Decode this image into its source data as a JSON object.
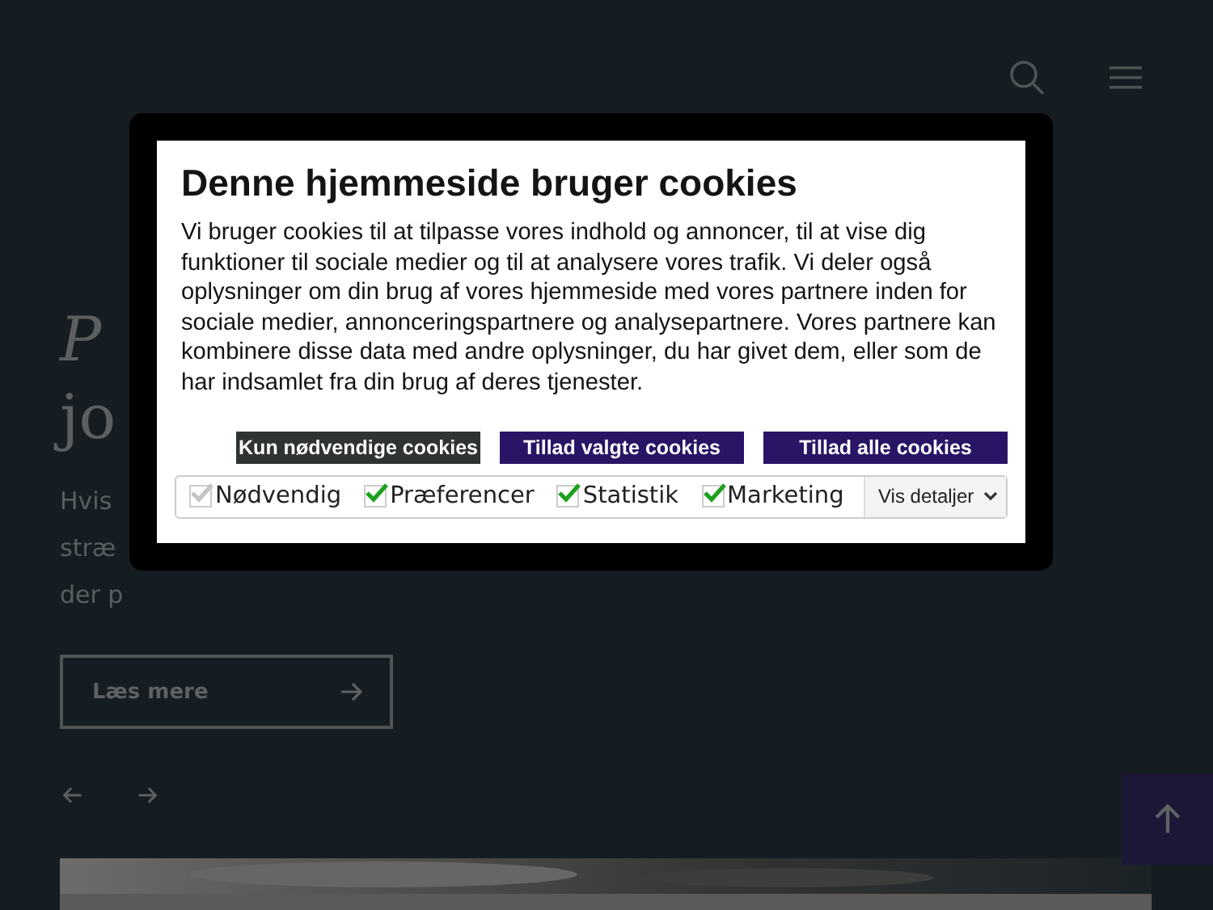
{
  "page": {
    "headline": [
      "P",
      "jo"
    ],
    "intro": [
      "Hvis",
      "stræ",
      "der p"
    ],
    "read_more": "Læs mere",
    "picture": {
      "kind": "picture"
    }
  },
  "dialog": {
    "title": "Denne hjemmeside bruger cookies",
    "body": "Vi bruger cookies til at tilpasse vores indhold og annoncer, til at vise dig funktioner til sociale medier og til at analysere vores trafik. Vi deler også oplysninger om din brug af vores hjemmeside med vores partnere inden for sociale medier, annonceringspartnere og analysepartnere. Vores partnere kan kombinere disse data med andre oplysninger, du har givet dem, eller som de har indsamlet fra din brug af deres tjenester.",
    "buttons": [
      {
        "label": "Kun nødvendige cookies",
        "kind": "dark"
      },
      {
        "label": "Tillad valgte cookies",
        "kind": "primary"
      },
      {
        "label": "Tillad alle cookies",
        "kind": "primary"
      }
    ],
    "consents": [
      {
        "label": "Nødvendig",
        "checked": true,
        "disabled": true
      },
      {
        "label": "Præferencer",
        "checked": true,
        "disabled": false
      },
      {
        "label": "Statistik",
        "checked": true,
        "disabled": false
      },
      {
        "label": "Marketing",
        "checked": true,
        "disabled": false
      }
    ],
    "details": "Vis detaljer"
  }
}
